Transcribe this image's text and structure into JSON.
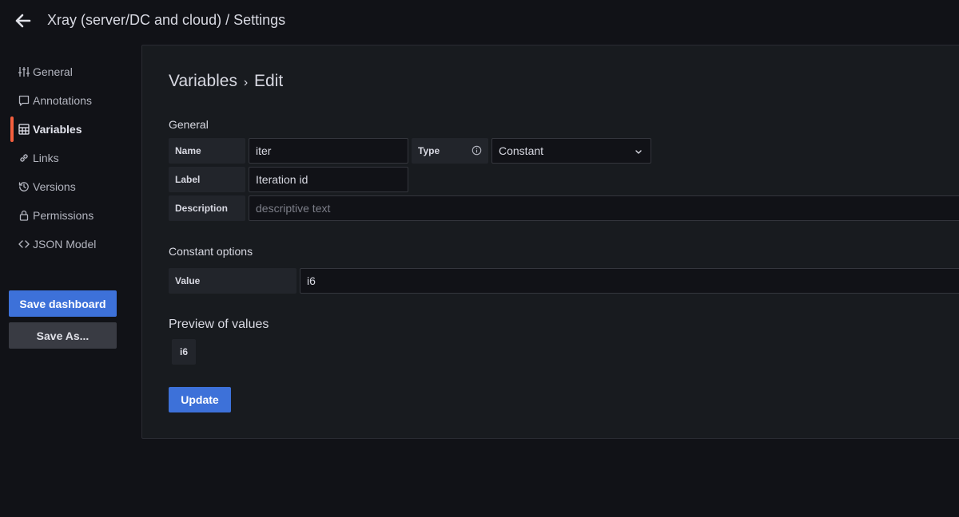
{
  "header": {
    "title": "Xray (server/DC and cloud) / Settings",
    "back_icon": "arrow-left-icon"
  },
  "sidebar": {
    "items": [
      {
        "label": "General",
        "icon": "sliders-icon",
        "active": false
      },
      {
        "label": "Annotations",
        "icon": "comment-icon",
        "active": false
      },
      {
        "label": "Variables",
        "icon": "calculator-icon",
        "active": true
      },
      {
        "label": "Links",
        "icon": "link-icon",
        "active": false
      },
      {
        "label": "Versions",
        "icon": "history-icon",
        "active": false
      },
      {
        "label": "Permissions",
        "icon": "lock-icon",
        "active": false
      },
      {
        "label": "JSON Model",
        "icon": "code-icon",
        "active": false
      }
    ],
    "save_dashboard": "Save dashboard",
    "save_as": "Save As..."
  },
  "main": {
    "breadcrumb_parent": "Variables",
    "breadcrumb_sep": "›",
    "breadcrumb_current": "Edit",
    "general_title": "General",
    "name_label": "Name",
    "name_value": "iter",
    "type_label": "Type",
    "type_value": "Constant",
    "label_label": "Label",
    "label_value": "Iteration id",
    "description_label": "Description",
    "description_placeholder": "descriptive text",
    "constant_options_title": "Constant options",
    "value_label": "Value",
    "value_value": "i6",
    "preview_title": "Preview of values",
    "preview_values": [
      "i6"
    ],
    "update_button": "Update"
  },
  "colors": {
    "accent": "#3d71d9",
    "active_indicator": "#f55f3e",
    "background": "#111217",
    "panel": "#181b1f"
  }
}
